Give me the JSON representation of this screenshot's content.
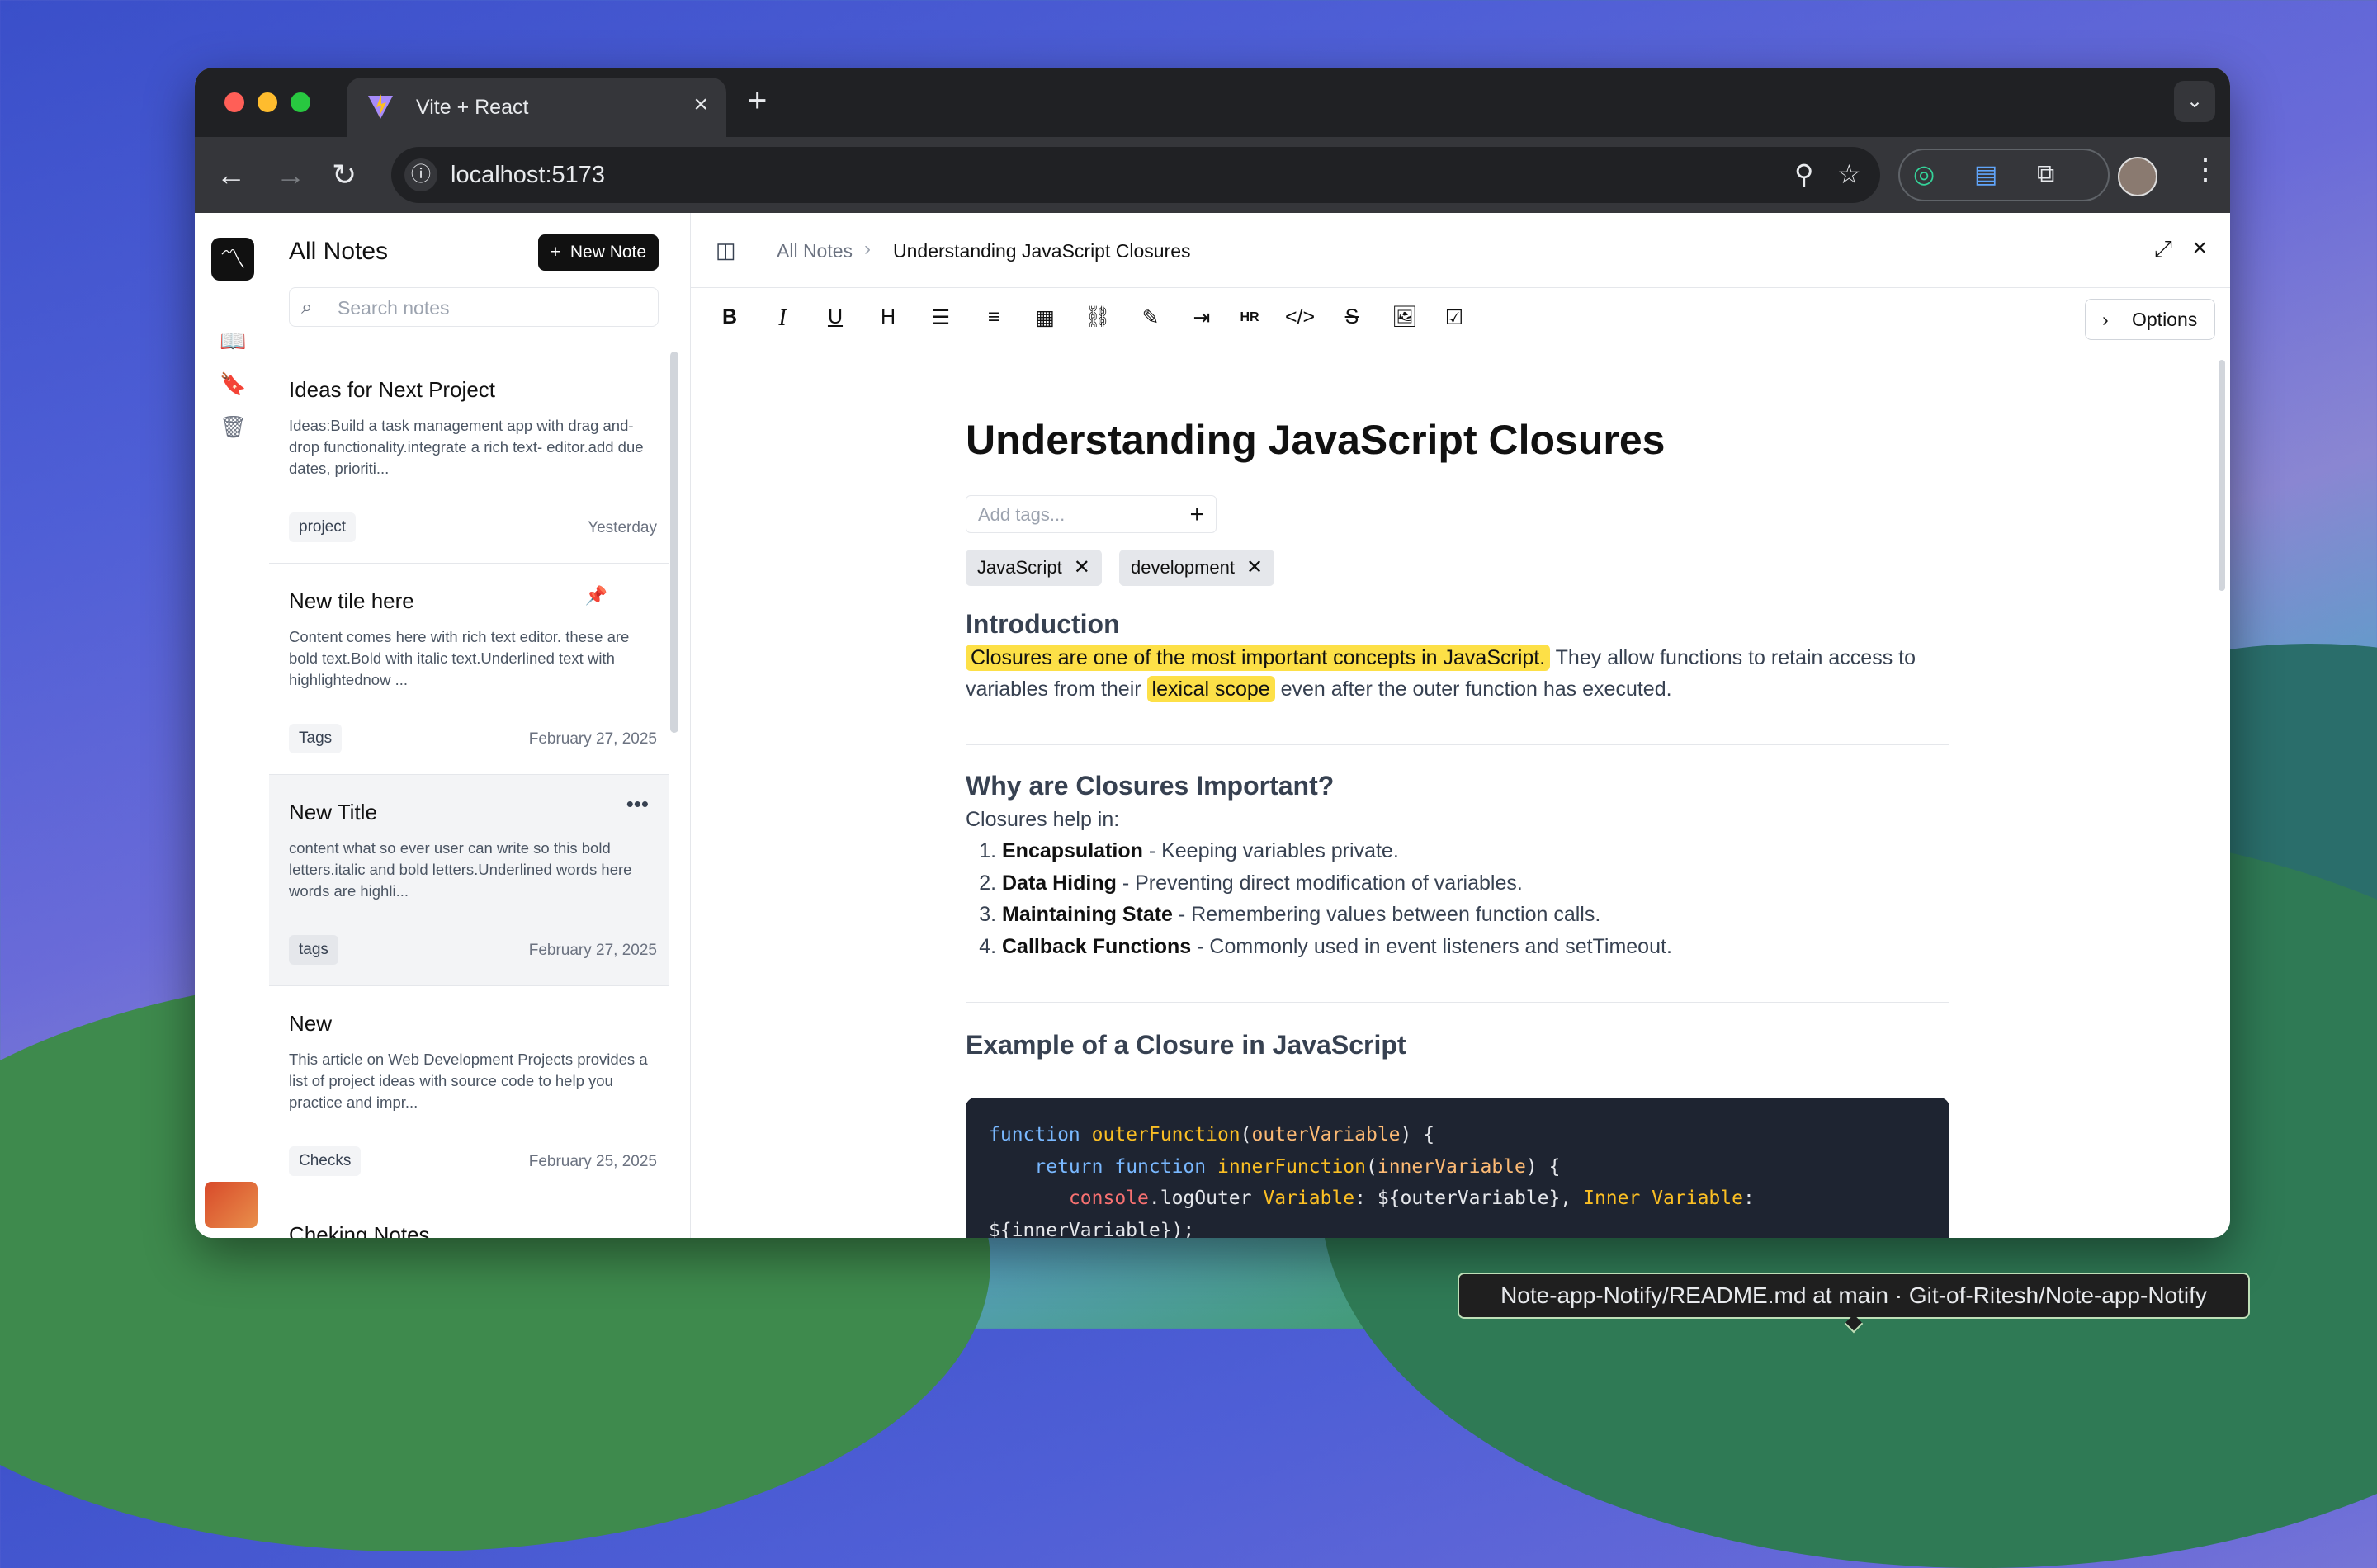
{
  "browser": {
    "tab_title": "Vite + React",
    "url": "localhost:5173",
    "tooltip": "Note-app-Notify/README.md at main · Git-of-Ritesh/Note-app-Notify"
  },
  "sidebar": {
    "heading": "All Notes",
    "new_note_label": "New Note",
    "search_placeholder": "Search notes",
    "notes": [
      {
        "title": "Ideas for Next Project",
        "excerpt": "Ideas:Build a task management app with drag and-drop functionality.integrate a rich text- editor.add due dates, prioriti...",
        "tag": "project",
        "date": "Yesterday"
      },
      {
        "title": "New tile here",
        "excerpt": "Content comes here with rich text editor. these are bold text.Bold with italic text.Underlined text with highlightednow ...",
        "tag": "Tags",
        "date": "February 27, 2025"
      },
      {
        "title": "New Title",
        "excerpt": "content what so ever user can write so this bold letters.italic and bold letters.Underlined words here words are highli...",
        "tag": "tags",
        "date": "February 27, 2025"
      },
      {
        "title": "New",
        "excerpt": "This article on Web Development Projects provides a list of project ideas with source code to help you practice and impr...",
        "tag": "Checks",
        "date": "February 25, 2025"
      },
      {
        "title": "Cheking Notes"
      }
    ]
  },
  "editor": {
    "breadcrumb_root": "All Notes",
    "breadcrumb_current": "Understanding JavaScript Closures",
    "options_label": "Options",
    "toolbar_labels": {
      "heading": "H",
      "hr": "HR"
    },
    "title": "Understanding JavaScript Closures",
    "tag_placeholder": "Add tags...",
    "tags": [
      "JavaScript",
      "development"
    ],
    "intro_heading": "Introduction",
    "intro_highlight": "Closures are one of the most important concepts in JavaScript.",
    "intro_text1": " They allow functions to retain access to variables from their ",
    "intro_highlight2": "lexical scope",
    "intro_text2": " even after the outer function has executed.",
    "why_heading": "Why are Closures Important?",
    "why_lead": "Closures help in:",
    "points": [
      {
        "term": "Encapsulation",
        "desc": " - Keeping variables private."
      },
      {
        "term": "Data Hiding",
        "desc": " - Preventing direct modification of variables."
      },
      {
        "term": "Maintaining State",
        "desc": " - Remembering values between function calls."
      },
      {
        "term": "Callback Functions",
        "desc": " - Commonly used in event listeners and setTimeout."
      }
    ],
    "example_heading": "Example of a Closure in JavaScript",
    "code": {
      "l1_kw": "function",
      "l1_fn": "outerFunction",
      "l1_p": "outerVariable",
      "l1_end": ") {",
      "l2_kw1": "return",
      "l2_kw2": "function",
      "l2_fn": "innerFunction",
      "l2_p": "innerVariable",
      "l2_end": ") {",
      "l3_obj": "console",
      "l3_a": ".logOuter ",
      "l3_b": "Variable",
      "l3_c": ": ${outerVariable}, ",
      "l3_d": "Inner Variable",
      "l3_e": ":",
      "l4": "${innerVariable});"
    }
  }
}
